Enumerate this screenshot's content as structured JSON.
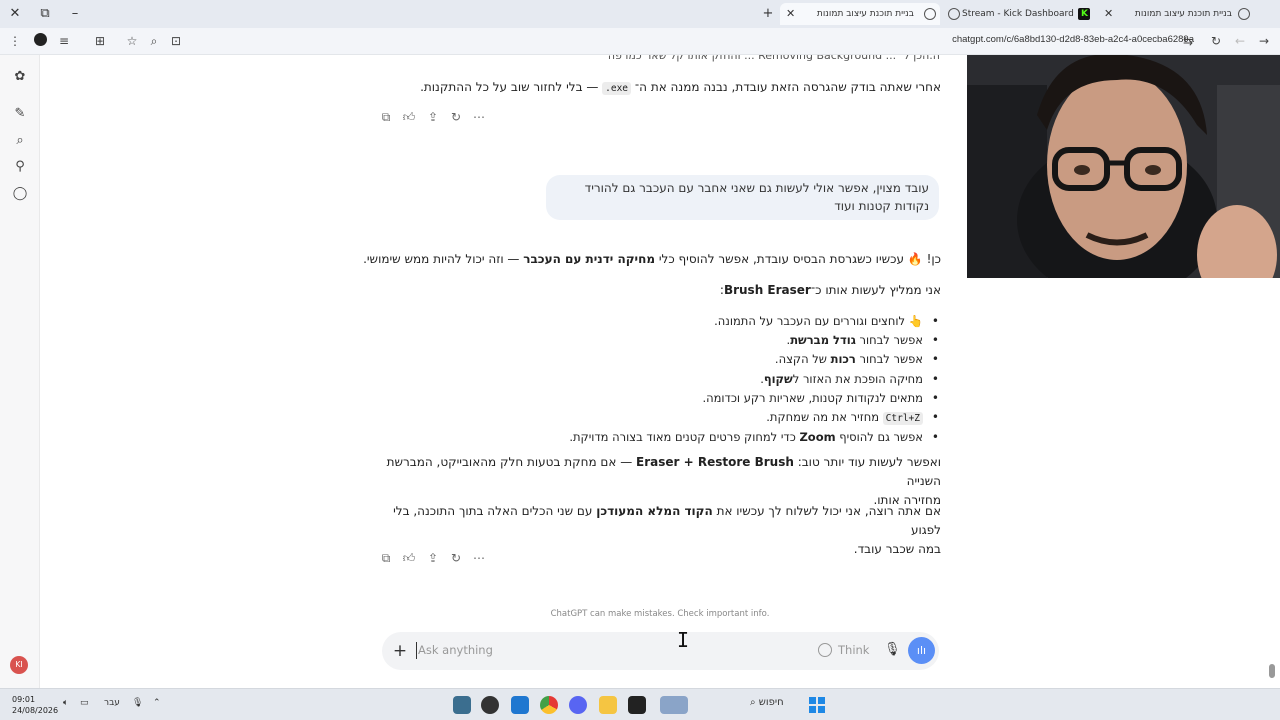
{
  "browser": {
    "tabs": [
      {
        "title": "בניית תוכנת עיצוב תמונות"
      },
      {
        "title": "Stream - Kick Dashboard"
      },
      {
        "title": "בניית תוכנת עיצוב תמונות"
      }
    ],
    "url": "chatgpt.com/c/6a8bd130-d2d8-83eb-a2c4-a0cecba6289a"
  },
  "chat": {
    "top_partial": "ה.הכן ל־ ... Removing Background ... והחזק אותו קל שאר כמו פה",
    "prev_reply_pre": "אחרי שאתה בודק שהגרסה הזאת עובדת, נבנה ממנה את ה־ ",
    "prev_reply_code": ".exe",
    "prev_reply_post": " — בלי לחזור שוב על כל ההתקנות.",
    "user_message_line1": "עובד מצוין, אפשר אולי לעשות גם שאני אחבר עם העכבר גם להוריד",
    "user_message_line2": "נקודות קטנות ועוד",
    "reply_p1_a": "כן! 🔥 עכשיו כשגרסת הבסיס עובדת, אפשר להוסיף כלי ",
    "reply_p1_b": "מחיקה ידנית עם העכבר",
    "reply_p1_c": " — וזה יכול להיות ממש שימושי.",
    "reply_p2_a": "אני ממליץ לעשות אותו כ־",
    "reply_p2_b": "Brush Eraser",
    "reply_p2_c": ":",
    "bullets": [
      {
        "a": "👆 לוחצים וגוררים עם העכבר על התמונה.",
        "b": "",
        "c": ""
      },
      {
        "a": "אפשר לבחור ",
        "b": "גודל מברשת",
        "c": "."
      },
      {
        "a": "אפשר לבחור ",
        "b": "רכות",
        "c": " של הקצה."
      },
      {
        "a": "מחיקה הופכת את האזור ל",
        "b": "שקוף",
        "c": "."
      },
      {
        "a": "מתאים לנקודות קטנות, שאריות רקע וכדומה.",
        "b": "",
        "c": ""
      },
      {
        "a": "",
        "b": "Ctrl+Z",
        "c": " מחזיר את מה שמחקת."
      },
      {
        "a": "אפשר גם להוסיף ",
        "b": "Zoom",
        "c": " כדי למחוק פרטים קטנים מאוד בצורה מדויקת."
      }
    ],
    "reply_p3_a": "ואפשר לעשות עוד יותר טוב: ",
    "reply_p3_b": "Eraser + Restore Brush",
    "reply_p3_c": " — אם מחקת בטעות חלק מהאובייקט, המברשת השנייה",
    "reply_p3_d": "מחזירה אותו.",
    "reply_p4_a": "אם אתה רוצה, אני יכול לשלוח לך עכשיו את ",
    "reply_p4_b": "הקוד המלא המעודכן",
    "reply_p4_c": " עם שני הכלים האלה בתוך התוכנה, בלי לפגוע",
    "reply_p4_d": "במה שכבר עובד."
  },
  "disclaimer": "ChatGPT can make mistakes. Check important info.",
  "composer": {
    "placeholder": "Ask anything",
    "think_label": "Think"
  },
  "rail": {
    "profile_initials": "KI"
  },
  "taskbar": {
    "time": "09:01",
    "date": "24/08/2026",
    "lang": "עבר",
    "search_label": "חיפוש"
  },
  "colors": {
    "accent": "#5b8ff6",
    "user_bubble": "#eef2f8",
    "kick_green": "#53fc18",
    "profile": "#d9534f"
  }
}
